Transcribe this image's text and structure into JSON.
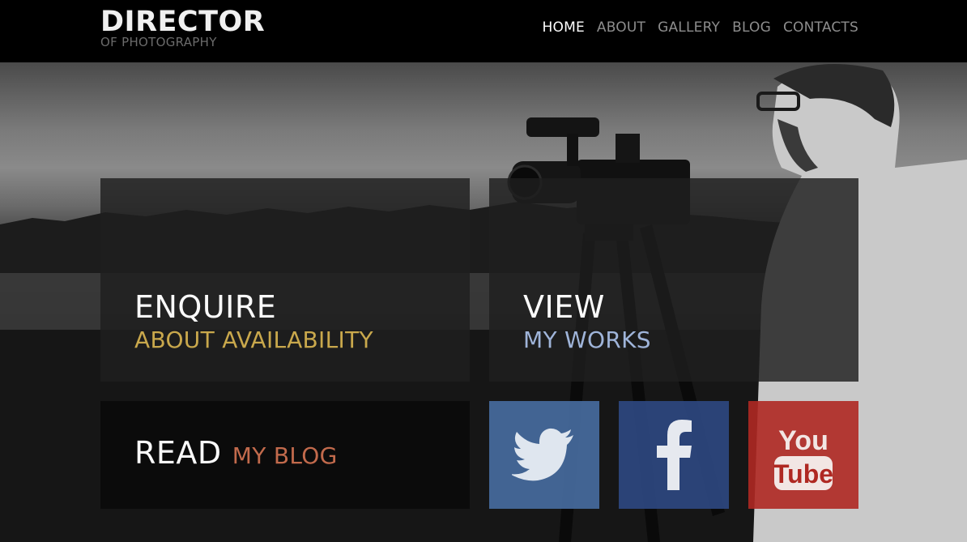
{
  "logo": {
    "title": "DIRECTOR",
    "subtitle": "OF PHOTOGRAPHY"
  },
  "nav": {
    "items": [
      {
        "label": "HOME",
        "active": true
      },
      {
        "label": "ABOUT",
        "active": false
      },
      {
        "label": "GALLERY",
        "active": false
      },
      {
        "label": "BLOG",
        "active": false
      },
      {
        "label": "CONTACTS",
        "active": false
      }
    ]
  },
  "tiles": {
    "enquire": {
      "title": "ENQUIRE",
      "subtitle": "ABOUT AVAILABILITY"
    },
    "view": {
      "title": "VIEW",
      "subtitle": "MY WORKS"
    },
    "blog": {
      "title": "READ",
      "subtitle": "MY BLOG"
    }
  },
  "social": {
    "twitter": {
      "icon": "twitter-icon",
      "color": "#4970a5"
    },
    "facebook": {
      "icon": "facebook-icon",
      "color": "#2d4882"
    },
    "youtube": {
      "icon": "youtube-icon",
      "color": "#af2822"
    }
  },
  "colors": {
    "accent_enquire": "#c9a84c",
    "accent_view": "#9fb4d9",
    "accent_blog": "#c26a4c"
  }
}
